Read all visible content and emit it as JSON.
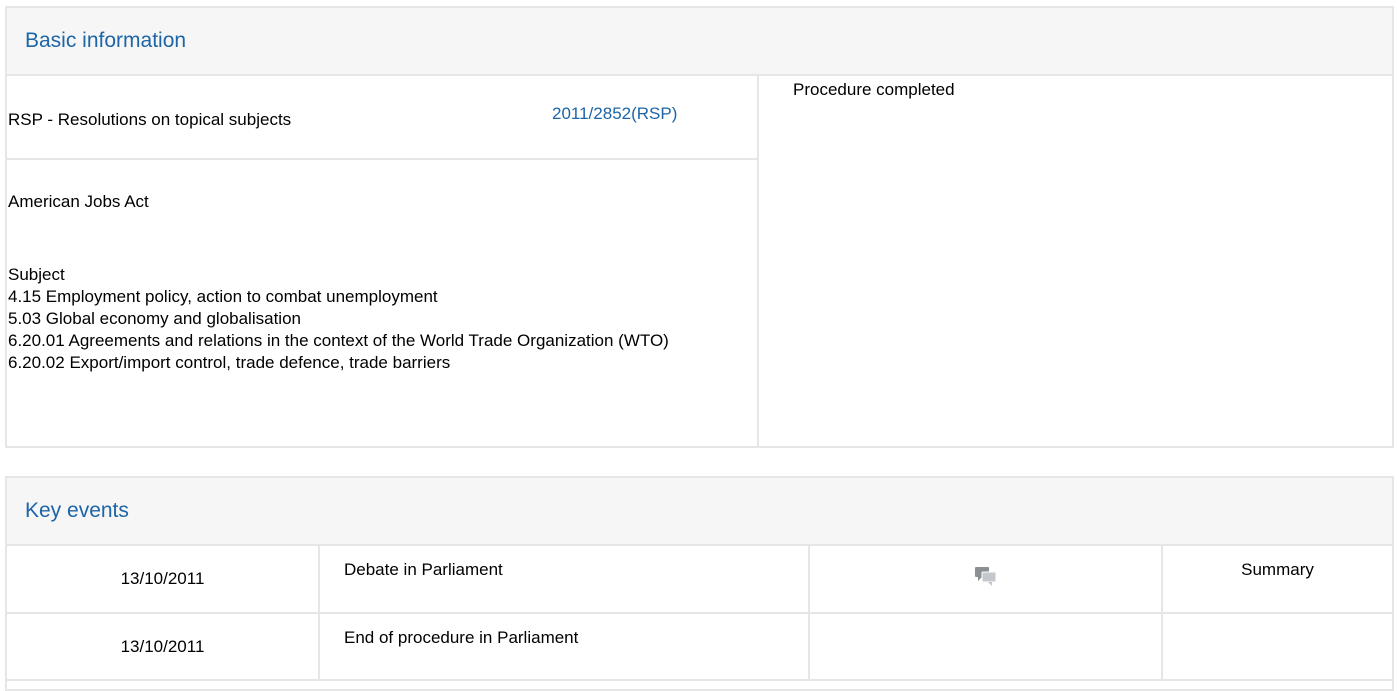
{
  "basic_information": {
    "header": "Basic information",
    "procedure_type": "RSP - Resolutions on topical subjects",
    "reference": "2011/2852(RSP)",
    "status": "Procedure completed",
    "title": "American Jobs Act",
    "subject_label": "Subject",
    "subjects": [
      "4.15 Employment policy, action to combat unemployment",
      "5.03 Global economy and globalisation",
      "6.20.01 Agreements and relations in the context of the World Trade Organization (WTO)",
      "6.20.02 Export/import control, trade defence, trade barriers"
    ]
  },
  "key_events": {
    "header": "Key events",
    "rows": [
      {
        "date": "13/10/2011",
        "event": "Debate in Parliament",
        "icon": "debate-icon",
        "summary": "Summary"
      },
      {
        "date": "13/10/2011",
        "event": "End of procedure in Parliament",
        "icon": "",
        "summary": ""
      }
    ]
  },
  "colors": {
    "link": "#1d65a6",
    "header_bg": "#f6f6f6",
    "border": "#e6e6e6"
  }
}
